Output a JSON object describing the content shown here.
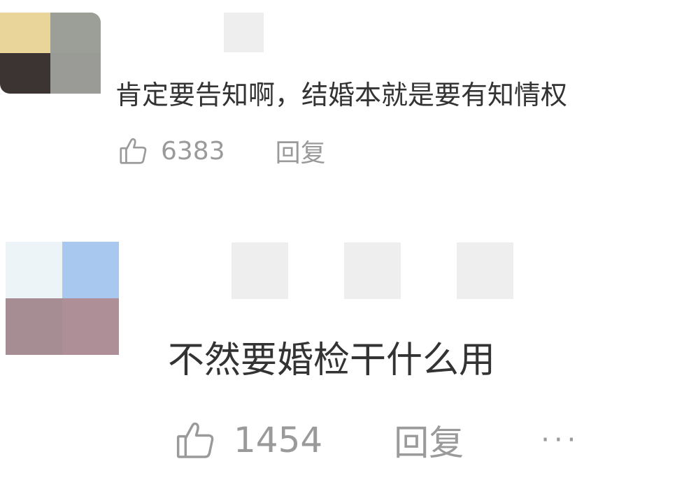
{
  "comments": [
    {
      "text": "肯定要告知啊，结婚本就是要有知情权",
      "likes": "6383",
      "reply_label": "回复",
      "avatar_colors": [
        "#e9d59a",
        "#9c9e98",
        "#3b3433",
        "#9a9b96"
      ],
      "name_color": "#eeeeee"
    },
    {
      "text": "不然要婚检干什么用",
      "likes": "1454",
      "reply_label": "回复",
      "more_label": "···",
      "avatar_colors": [
        "#ecf4f7",
        "#a9c8ef",
        "#a68c93",
        "#ae8e97"
      ],
      "name_color": "#eeeeee"
    }
  ],
  "icons": {
    "like": "thumbs-up-icon",
    "more": "more-icon"
  }
}
